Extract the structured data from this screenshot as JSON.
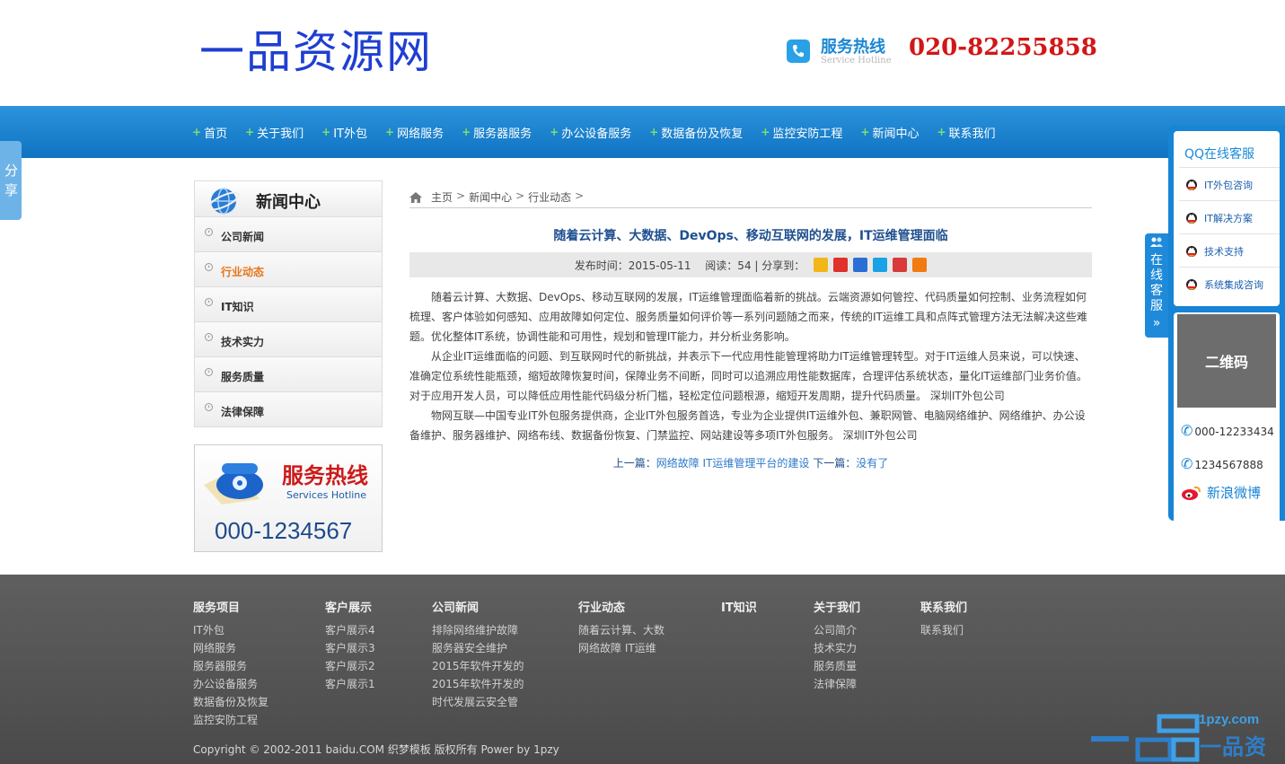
{
  "header": {
    "logo": "一品资源网",
    "hotline_title": "服务热线",
    "hotline_subtitle": "Service Hotline",
    "hotline_number": "020-82255858"
  },
  "nav": {
    "items": [
      "首页",
      "关于我们",
      "IT外包",
      "网络服务",
      "服务器服务",
      "办公设备服务",
      "数据备份及恢复",
      "监控安防工程",
      "新闻中心",
      "联系我们"
    ]
  },
  "share_tab": {
    "label": "分享"
  },
  "sidebar": {
    "title": "新闻中心",
    "items": [
      {
        "label": "公司新闻",
        "active": false
      },
      {
        "label": "行业动态",
        "active": true
      },
      {
        "label": "IT知识",
        "active": false
      },
      {
        "label": "技术实力",
        "active": false
      },
      {
        "label": "服务质量",
        "active": false
      },
      {
        "label": "法律保障",
        "active": false
      }
    ],
    "hotline_title": "服务热线",
    "hotline_subtitle": "Services Hotline",
    "hotline_number": "000-1234567"
  },
  "breadcrumb": {
    "items": [
      "主页",
      "新闻中心",
      "行业动态"
    ],
    "separator": ">"
  },
  "article": {
    "title": "随着云计算、大数据、DevOps、移动互联网的发展，IT运维管理面临",
    "meta": "发布时间：2015-05-11　 阅读：54 | 分享到：",
    "paragraphs": [
      "随着云计算、大数据、DevOps、移动互联网的发展，IT运维管理面临着新的挑战。云端资源如何管控、代码质量如何控制、业务流程如何梳理、客户体验如何感知、应用故障如何定位、服务质量如何评价等一系列问题随之而来，传统的IT运维工具和点阵式管理方法无法解决这些难题。优化整体IT系统，协调性能和可用性，规划和管理IT能力，并分析业务影响。",
      "从企业IT运维面临的问题、到互联网时代的新挑战，并表示下一代应用性能管理将助力IT运维管理转型。对于IT运维人员来说，可以快速、准确定位系统性能瓶颈，缩短故障恢复时间，保障业务不间断，同时可以追溯应用性能数据库，合理评估系统状态，量化IT运维部门业务价值。对于应用开发人员，可以降低应用性能代码级分析门槛，轻松定位问题根源，缩短开发周期，提升代码质量。 深圳IT外包公司",
      "物网互联—中国专业IT外包服务提供商，企业IT外包服务首选，专业为企业提供IT运维外包、兼职网管、电脑网络维护、网络维护、办公设备维护、服务器维护、网络布线、数据备份恢复、门禁监控、网站建设等多项IT外包服务。 深圳IT外包公司"
    ],
    "prev_label": "上一篇：",
    "prev_link": "网络故障 IT运维管理平台的建设",
    "next_label": " 下一篇：",
    "next_link": "没有了"
  },
  "share_icon_colors": [
    "#f2b619",
    "#e0312b",
    "#2a6fd6",
    "#1aa2e6",
    "#d93a3a",
    "#f07b12"
  ],
  "float_panel": {
    "online_tab": "在线客服",
    "qq_title": "QQ在线客服",
    "qq_items": [
      "IT外包咨询",
      "IT解决方案",
      "技术支持",
      "系统集成咨询"
    ],
    "qr_label": "二维码",
    "phones": [
      "000-12233434",
      "1234567888"
    ],
    "weibo": "新浪微博"
  },
  "footer": {
    "columns": [
      {
        "heading": "服务项目",
        "links": [
          "IT外包",
          "网络服务",
          "服务器服务",
          "办公设备服务",
          "数据备份及恢复",
          "监控安防工程"
        ]
      },
      {
        "heading": "客户展示",
        "links": [
          "客户展示4",
          "客户展示3",
          "客户展示2",
          "客户展示1"
        ]
      },
      {
        "heading": "公司新闻",
        "links": [
          "排除网络维护故障",
          "服务器安全维护",
          "2015年软件开发的",
          "2015年软件开发的",
          "时代发展云安全管"
        ]
      },
      {
        "heading": "行业动态",
        "links": [
          "随着云计算、大数",
          "网络故障 IT运维"
        ]
      },
      {
        "heading": "IT知识",
        "links": []
      },
      {
        "heading": "关于我们",
        "links": [
          "公司简介",
          "技术实力",
          "服务质量",
          "法律保障"
        ]
      },
      {
        "heading": "联系我们",
        "links": [
          "联系我们"
        ]
      }
    ],
    "copyright": "Copyright © 2002-2011 baidu.COM 织梦模板 版权所有 Power by 1pzy"
  },
  "watermark": {
    "domain": "1pzy.com",
    "text": "一品资源网"
  }
}
